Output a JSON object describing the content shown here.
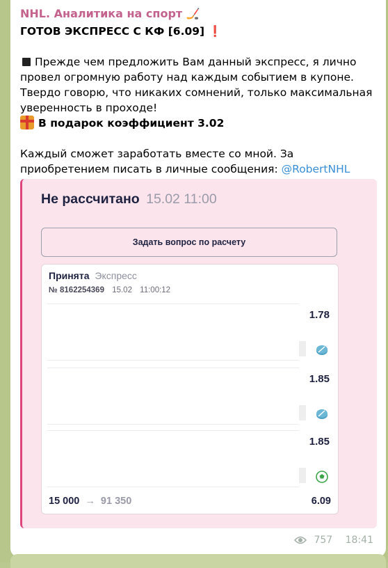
{
  "channel": {
    "name": "NHL. Аналитика на спорт",
    "name_icon": "hockey-stick-icon"
  },
  "post": {
    "headline": "ГОТОВ ЭКСПРЕСС С КФ [6.09]",
    "headline_icon": "red-exclamation-icon",
    "paragraph1": "Прежде чем предложить Вам данный экспресс, я лично провел огромную работу над каждым событием в купоне. Твердо говорю, что никаких сомнений, только максимальная уверенность в проходе!",
    "paragraph1_icon": "black-square-icon",
    "gift_line": "В подарок коэффициент 3.02",
    "gift_icon": "gift-icon",
    "paragraph2": "Каждый сможет заработать вместе со мной. За приобретением писать в личные сообщения: ",
    "contact_link": "@RobertNHL"
  },
  "bet_card": {
    "status_title": "Не рассчитано",
    "datetime": "15.02 11:00",
    "ask_button": "Задать вопрос по расчету",
    "coupon": {
      "status": "Принята",
      "type": "Экспресс",
      "number": "№ 8162254369",
      "date": "15.02",
      "time": "11:00:12",
      "events": [
        {
          "odds": "1.78",
          "sport_icon": "hockey-puck-icon"
        },
        {
          "odds": "1.85",
          "sport_icon": "hockey-puck-icon"
        },
        {
          "odds": "1.85",
          "sport_icon": "football-icon"
        }
      ],
      "stake": "15 000",
      "payout": "91 350",
      "total_odds": "6.09"
    }
  },
  "footer": {
    "views": "757",
    "time": "18:41"
  },
  "colors": {
    "channel_name": "#c4628e",
    "link": "#3a8fd6",
    "card_accent": "#e0467e",
    "card_bg": "#fbe4ec",
    "puck": "#4a9fc4",
    "football": "#3ea44a"
  }
}
